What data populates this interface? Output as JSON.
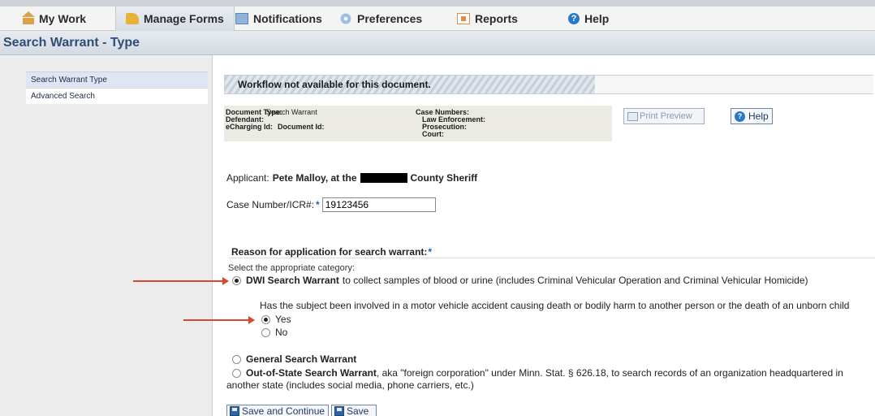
{
  "nav": {
    "items": [
      {
        "label": "My Work",
        "icon": "home-icon"
      },
      {
        "label": "Manage Forms",
        "icon": "forms-icon"
      },
      {
        "label": "Notifications",
        "icon": "notification-icon"
      },
      {
        "label": "Preferences",
        "icon": "preferences-icon"
      },
      {
        "label": "Reports",
        "icon": "reports-icon"
      },
      {
        "label": "Help",
        "icon": "help-icon"
      }
    ]
  },
  "page": {
    "title": "Search Warrant - Type"
  },
  "sidebar": {
    "items": [
      {
        "label": "Search Warrant Type",
        "active": true
      },
      {
        "label": "Advanced Search",
        "active": false
      }
    ]
  },
  "workflow": {
    "banner": "Workflow not available for this document."
  },
  "document": {
    "type_label": "Document Type:",
    "type_value": "Search Warrant",
    "defendant_label": "Defendant:",
    "echarging_label": "eCharging Id:",
    "document_id_label": "Document Id:",
    "case_numbers_label": "Case Numbers:",
    "law_enforcement_label": "Law Enforcement:",
    "prosecution_label": "Prosecution:",
    "court_label": "Court:"
  },
  "buttons": {
    "print_preview": "Print Preview",
    "help": "Help",
    "save_and_continue": "Save and Continue",
    "save": "Save"
  },
  "applicant": {
    "label": "Applicant:",
    "name": "Pete Malloy, at the",
    "agency": "County Sheriff"
  },
  "case": {
    "label": "Case Number/ICR#:",
    "required_mark": "*",
    "value": "19123456"
  },
  "reason": {
    "heading": "Reason for application for search warrant:",
    "required_mark": "*",
    "instruction": "Select the appropriate category:",
    "options": [
      {
        "title": "DWI Search Warrant",
        "desc": "to collect samples of blood or urine (includes Criminal Vehicular Operation and Criminal Vehicular Homicide)",
        "selected": true
      },
      {
        "title": "General Search Warrant",
        "desc": "",
        "selected": false
      },
      {
        "title": "Out-of-State Search Warrant",
        "desc": ", aka \"foreign corporation\" under Minn. Stat. § 626.18, to search records of an organization headquartered in",
        "desc2": "another state (includes social media, phone carriers, etc.)",
        "selected": false
      }
    ],
    "subquestion": "Has the subject been involved in a motor vehicle accident causing death or bodily harm to another person or the death of an unborn child",
    "sub_options": [
      {
        "label": "Yes",
        "selected": true
      },
      {
        "label": "No",
        "selected": false
      }
    ]
  },
  "colors": {
    "title": "#2e4e78",
    "annotation_arrow": "#d9472e",
    "required": "#1f5fbf"
  }
}
